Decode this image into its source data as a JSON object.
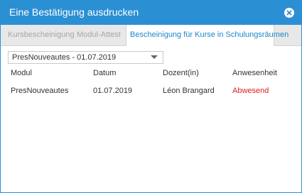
{
  "dialog": {
    "title": "Eine Bestätigung ausdrucken",
    "close_icon": "close-circle-icon"
  },
  "tabs": [
    {
      "label": "Kursbescheinigung",
      "active": false
    },
    {
      "label": "Modul-Attest",
      "active": false
    },
    {
      "label": "Bescheinigung für Kurse in Schulungsräumen",
      "active": true
    }
  ],
  "session_select": {
    "value": "PresNouveautes - 01.07.2019"
  },
  "table": {
    "headers": [
      "Modul",
      "Datum",
      "Dozent(in)",
      "Anwesenheit"
    ],
    "rows": [
      {
        "modul": "PresNouveautes",
        "datum": "01.07.2019",
        "dozent": "Léon Brangard",
        "anwesenheit": "Abwesend"
      }
    ]
  },
  "colors": {
    "accent": "#2b8fd4",
    "active_tab_text": "#1d87c8",
    "absent": "#e02020"
  }
}
